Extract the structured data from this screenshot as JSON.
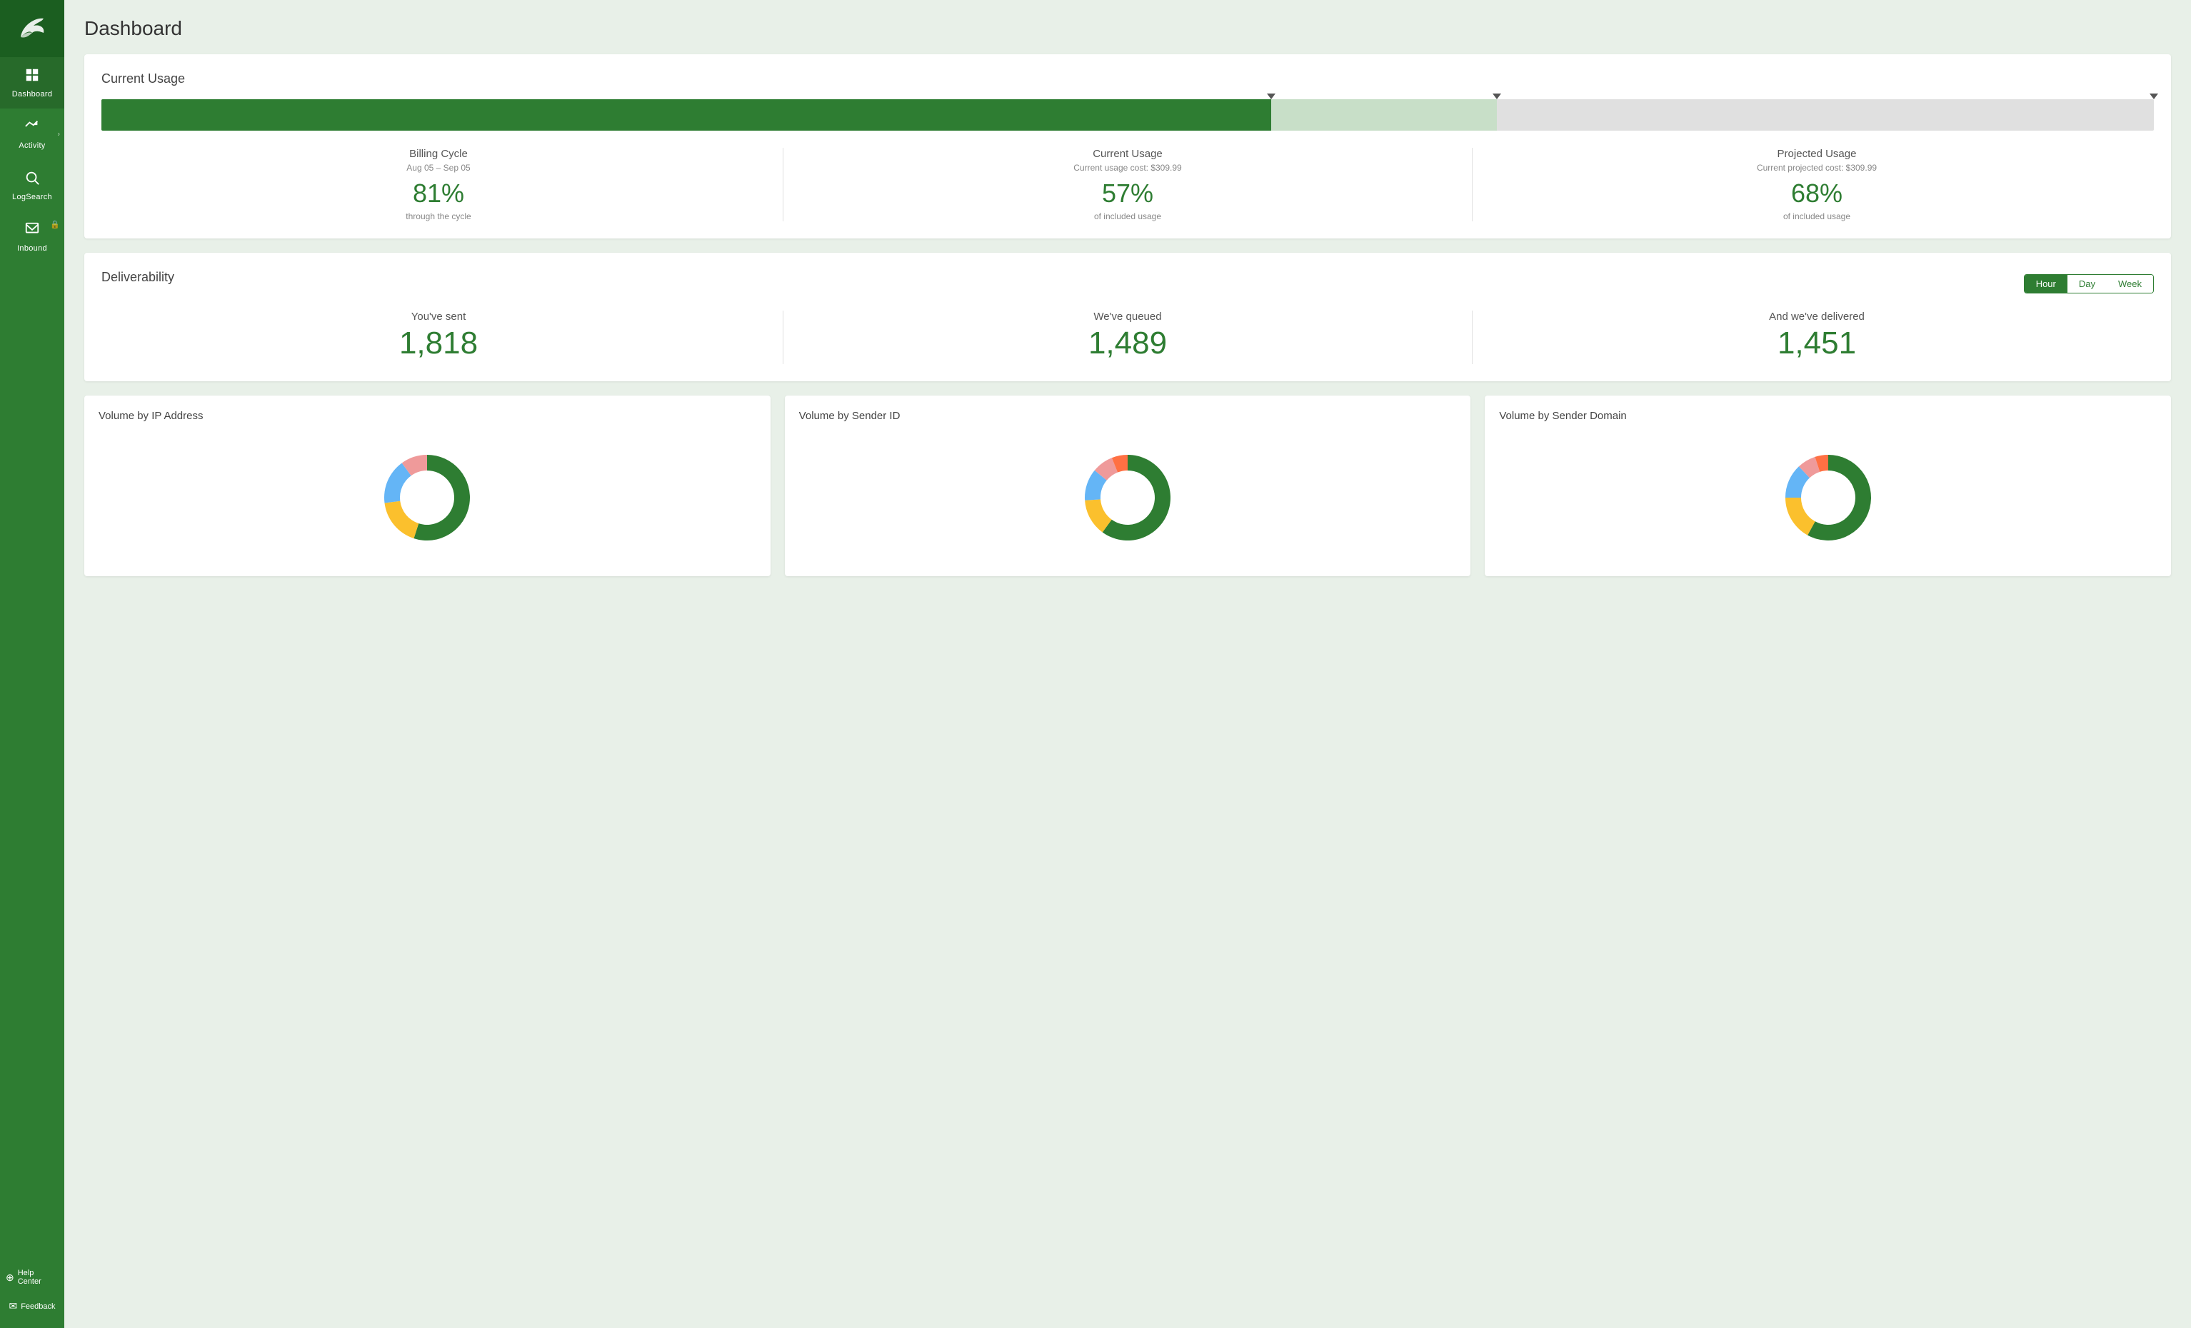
{
  "sidebar": {
    "logo_alt": "SendGrid logo",
    "items": [
      {
        "id": "dashboard",
        "label": "Dashboard",
        "icon": "📊",
        "active": true,
        "arrow": false,
        "lock": false
      },
      {
        "id": "activity",
        "label": "Activity",
        "icon": "✈",
        "active": false,
        "arrow": true,
        "lock": false
      },
      {
        "id": "logsearch",
        "label": "LogSearch",
        "icon": "🔍",
        "active": false,
        "arrow": false,
        "lock": false
      },
      {
        "id": "inbound",
        "label": "Inbound",
        "icon": "📥",
        "active": false,
        "arrow": false,
        "lock": true
      }
    ],
    "bottom_items": [
      {
        "id": "help",
        "label": "Help Center",
        "icon": "⊕"
      },
      {
        "id": "feedback",
        "label": "Feedback",
        "icon": "✉"
      }
    ]
  },
  "page": {
    "title": "Dashboard"
  },
  "current_usage": {
    "title": "Current Usage",
    "bar": {
      "fill_percent": 57,
      "projected_percent": 68,
      "marker1_percent": 57,
      "marker2_percent": 68,
      "marker3_percent": 100
    },
    "billing_cycle": {
      "label": "Billing Cycle",
      "date_range": "Aug 05 – Sep 05",
      "value": "81%",
      "desc": "through the cycle"
    },
    "current_usage": {
      "label": "Current Usage",
      "sublabel": "Current usage cost: $309.99",
      "value": "57%",
      "desc": "of included usage"
    },
    "projected_usage": {
      "label": "Projected Usage",
      "sublabel": "Current projected cost: $309.99",
      "value": "68%",
      "desc": "of included usage"
    }
  },
  "deliverability": {
    "title": "Deliverability",
    "time_options": [
      "Hour",
      "Day",
      "Week"
    ],
    "active_time": "Hour",
    "sent": {
      "label": "You've sent",
      "value": "1,818"
    },
    "queued": {
      "label": "We've queued",
      "value": "1,489"
    },
    "delivered": {
      "label": "And we've delivered",
      "value": "1,451"
    }
  },
  "charts": [
    {
      "id": "ip-address",
      "title": "Volume by IP Address",
      "segments": [
        {
          "color": "#2e7d32",
          "value": 55
        },
        {
          "color": "#fbc02d",
          "value": 18
        },
        {
          "color": "#64b5f6",
          "value": 17
        },
        {
          "color": "#ef9a9a",
          "value": 10
        }
      ]
    },
    {
      "id": "sender-id",
      "title": "Volume by Sender ID",
      "segments": [
        {
          "color": "#2e7d32",
          "value": 60
        },
        {
          "color": "#fbc02d",
          "value": 14
        },
        {
          "color": "#64b5f6",
          "value": 12
        },
        {
          "color": "#ef9a9a",
          "value": 8
        },
        {
          "color": "#ff7043",
          "value": 6
        }
      ]
    },
    {
      "id": "sender-domain",
      "title": "Volume by Sender Domain",
      "segments": [
        {
          "color": "#2e7d32",
          "value": 58
        },
        {
          "color": "#fbc02d",
          "value": 17
        },
        {
          "color": "#64b5f6",
          "value": 13
        },
        {
          "color": "#ef9a9a",
          "value": 7
        },
        {
          "color": "#ff7043",
          "value": 5
        }
      ]
    }
  ]
}
